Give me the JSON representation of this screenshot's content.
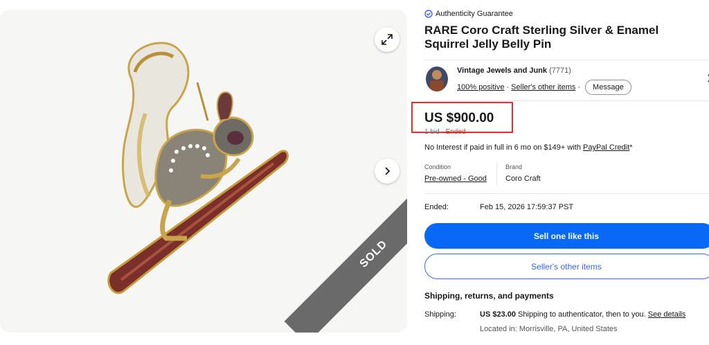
{
  "gallery": {
    "sold_label": "SOLD"
  },
  "listing": {
    "authenticity": "Authenticity Guarantee",
    "title": "RARE Coro Craft Sterling Silver & Enamel Squirrel Jelly Belly Pin"
  },
  "seller": {
    "name": "Vintage Jewels and Junk",
    "feedback_count": "(7771)",
    "positive": "100% positive",
    "separator1": "·",
    "other_items_link": "Seller's other items",
    "separator2": "·",
    "message_button": "Message"
  },
  "price": {
    "value": "US $900.00",
    "bids": "1 bid",
    "dot": " · ",
    "status": "Ended"
  },
  "financing": {
    "text": "No Interest if paid in full in 6 mo on $149+ with ",
    "link": "PayPal Credit",
    "suffix": "*"
  },
  "item_specifics": {
    "condition_label": "Condition",
    "condition_value": "Pre-owned - Good",
    "brand_label": "Brand",
    "brand_value": "Coro Craft"
  },
  "ended": {
    "label": "Ended:",
    "value": "Feb 15, 2026 17:59:37 PST"
  },
  "actions": {
    "sell_one": "Sell one like this",
    "sellers_other_items": "Seller's other items"
  },
  "shipping": {
    "heading": "Shipping, returns, and payments",
    "label": "Shipping:",
    "price": "US $23.00",
    "desc": " Shipping to authenticator, then to you. ",
    "details_link": "See details",
    "location": "Located in: Morrisville, PA, United States"
  },
  "colors": {
    "primary": "#0968f6",
    "secondary_border": "#3665f3",
    "highlight_box": "#e03030"
  }
}
